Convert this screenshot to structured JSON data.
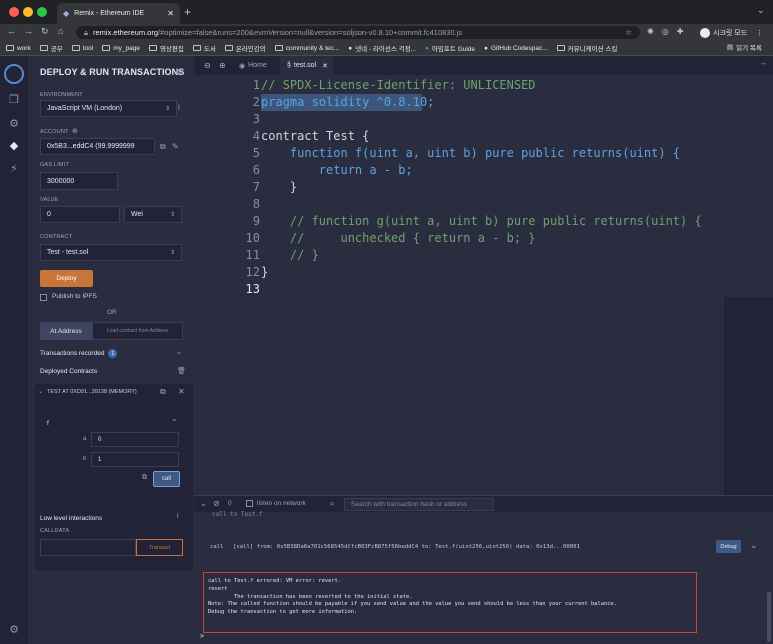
{
  "browser": {
    "tab_title": "Remix - Ethereum IDE",
    "url_domain": "remix.ethereum.org",
    "url_rest": "/#optimize=false&runs=200&evmVersion=null&version=soljson-v0.8.10+commit.fc410830.js",
    "incognito_label": "시크릿 모드",
    "bookmarks": [
      "work",
      "공부",
      "tool",
      "my_page",
      "영상편집",
      "도서",
      "온라인강의",
      "community & tec...",
      "넷네 - 라이선스 걱정...",
      "아임포트 Guide",
      "GitHub Codespac...",
      "커뮤니케이션 스킬"
    ],
    "reading_list": "읽기 목록"
  },
  "sidepanel": {
    "title": "DEPLOY & RUN TRANSACTIONS",
    "environment_label": "ENVIRONMENT",
    "environment_value": "JavaScript VM (London)",
    "account_label": "ACCOUNT",
    "account_value": "0x5B3...eddC4 (99.9999999",
    "gas_limit_label": "GAS LIMIT",
    "gas_limit_value": "3000000",
    "value_label": "VALUE",
    "value_amount": "0",
    "value_unit": "Wei",
    "contract_label": "CONTRACT",
    "contract_value": "Test - test.sol",
    "deploy_label": "Deploy",
    "publish_ipfs_label": "Publish to IPFS",
    "or_label": "OR",
    "at_address_label": "At Address",
    "load_address_placeholder": "Load contract from Address",
    "transactions_recorded_label": "Transactions recorded",
    "transactions_recorded_count": "1",
    "deployed_contracts_label": "Deployed Contracts",
    "instance_title": "TEST AT 0XD91...39138 (MEMORY)",
    "function_name": "f",
    "param_a_label": "a",
    "param_a_value": "0",
    "param_b_label": "b",
    "param_b_value": "1",
    "call_label": "call",
    "low_level_label": "Low level interactions",
    "calldata_label": "CALLDATA",
    "transact_label": "Transact"
  },
  "editor": {
    "home_tab": "Home",
    "file_tab": "test.sol",
    "line_numbers": [
      "1",
      "2",
      "3",
      "4",
      "5",
      "6",
      "7",
      "8",
      "9",
      "10",
      "11",
      "12",
      "13"
    ],
    "lines": [
      "// SPDX-License-Identifier: UNLICENSED",
      "pragma solidity ^0.8.10;",
      "",
      "contract Test {",
      "    function f(uint a, uint b) pure public returns(uint) {",
      "        return a - b;",
      "    }",
      "",
      "    // function g(uint a, uint b) pure public returns(uint) {",
      "    //     unchecked { return a - b; }",
      "    // }",
      "}",
      ""
    ]
  },
  "terminal": {
    "pending_count": "0",
    "listen_label": "listen on network",
    "search_placeholder": "Search with transaction hash or address",
    "cut_line": "call to Test.f",
    "call_tag": "call",
    "call_line": "[call] from: 0x5B38Da6a701c568545dCfcB03FcB875f56beddC4 to: Test.f(uint256,uint256) data: 0x13d...00001",
    "debug_label": "Debug",
    "error_lines": [
      "call to Test.f errored: VM error: revert.",
      "",
      "revert",
      "        The transaction has been reverted to the initial state.",
      "Note: The called function should be payable if you send value and the value you send should be less than your current balance.",
      "Debug the transaction to get more information."
    ],
    "prompt": ">"
  },
  "colors": {
    "accent_orange": "#c97539",
    "error_border": "#c84631",
    "comment_green": "#6ba36b",
    "keyword_blue": "#5ca4e0"
  }
}
